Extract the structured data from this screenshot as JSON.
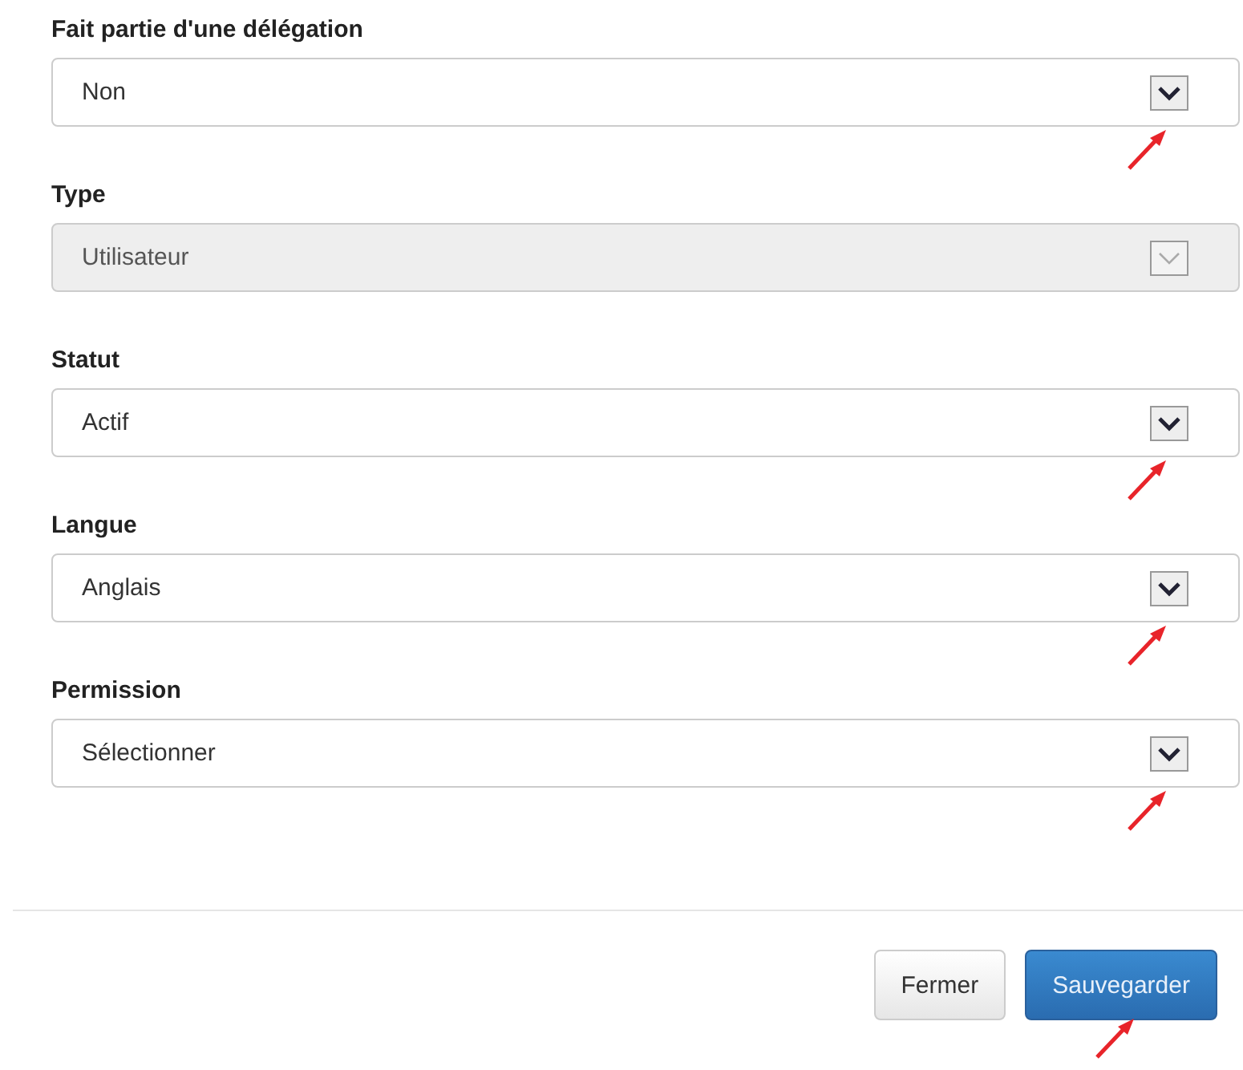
{
  "fields": [
    {
      "label": "Fait partie d'une délégation",
      "value": "Non",
      "disabled": false,
      "annotated": true
    },
    {
      "label": "Type",
      "value": "Utilisateur",
      "disabled": true,
      "annotated": false
    },
    {
      "label": "Statut",
      "value": "Actif",
      "disabled": false,
      "annotated": true
    },
    {
      "label": "Langue",
      "value": "Anglais",
      "disabled": false,
      "annotated": true
    },
    {
      "label": "Permission",
      "value": "Sélectionner",
      "disabled": false,
      "annotated": true
    }
  ],
  "buttons": [
    {
      "label": "Fermer",
      "kind": "default",
      "annotated": false
    },
    {
      "label": "Sauvegarder",
      "kind": "primary",
      "annotated": true
    }
  ]
}
